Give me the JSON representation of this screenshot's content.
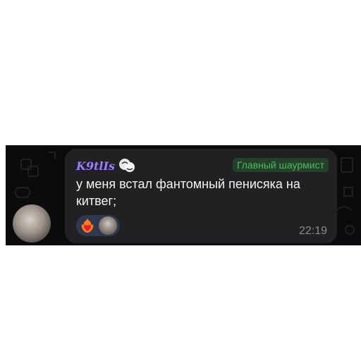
{
  "message": {
    "sender_name": "K9tlIs",
    "admin_title": "Главный шаурмист",
    "text": "у меня встал фантомный пенисяка на китвег;",
    "time": "22:19",
    "reactions": [
      {
        "emoji": "heart-on-fire",
        "reactor": "user-avatar"
      }
    ]
  },
  "colors": {
    "chat_background": "#0b0b0d",
    "bubble": "#212124",
    "sender_name": "#9d7cff",
    "admin_title": "#4fbb5e",
    "reaction_pill": "#2f3850"
  },
  "icons": {
    "sender_emoji": "sticker-emoji-icon",
    "reaction_emoji": "heart-on-fire-icon"
  }
}
